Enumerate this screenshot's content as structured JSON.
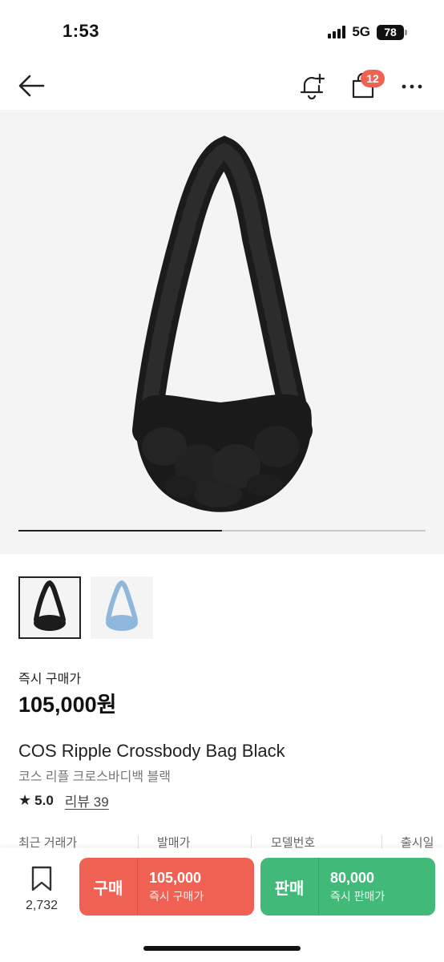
{
  "status": {
    "time": "1:53",
    "network": "5G",
    "battery": "78"
  },
  "nav": {
    "cart_count": "12",
    "icons": [
      "back-arrow-icon",
      "bell-plus-icon",
      "shopping-bag-icon",
      "more-icon"
    ]
  },
  "gallery": {
    "position": 1,
    "count": 2,
    "thumbnails": [
      {
        "name": "black-bag-thumbnail",
        "color": "#1c1c1c"
      },
      {
        "name": "blue-bag-thumbnail",
        "color": "#8fb7dc"
      }
    ]
  },
  "price": {
    "label": "즉시 구매가",
    "value": "105,000원"
  },
  "product": {
    "name": "COS Ripple Crossbody Bag Black",
    "korean_name": "코스 리플 크로스바디백 블랙",
    "rating": "5.0",
    "review_label": "리뷰 39"
  },
  "info_columns": [
    "최근 거래가",
    "발매가",
    "모델번호",
    "출시일"
  ],
  "actions": {
    "wish_count": "2,732",
    "buy": {
      "label": "구매",
      "price": "105,000",
      "sub": "즉시 구매가",
      "color": "#ef6253"
    },
    "sell": {
      "label": "판매",
      "price": "80,000",
      "sub": "즉시 판매가",
      "color": "#41b979"
    }
  }
}
